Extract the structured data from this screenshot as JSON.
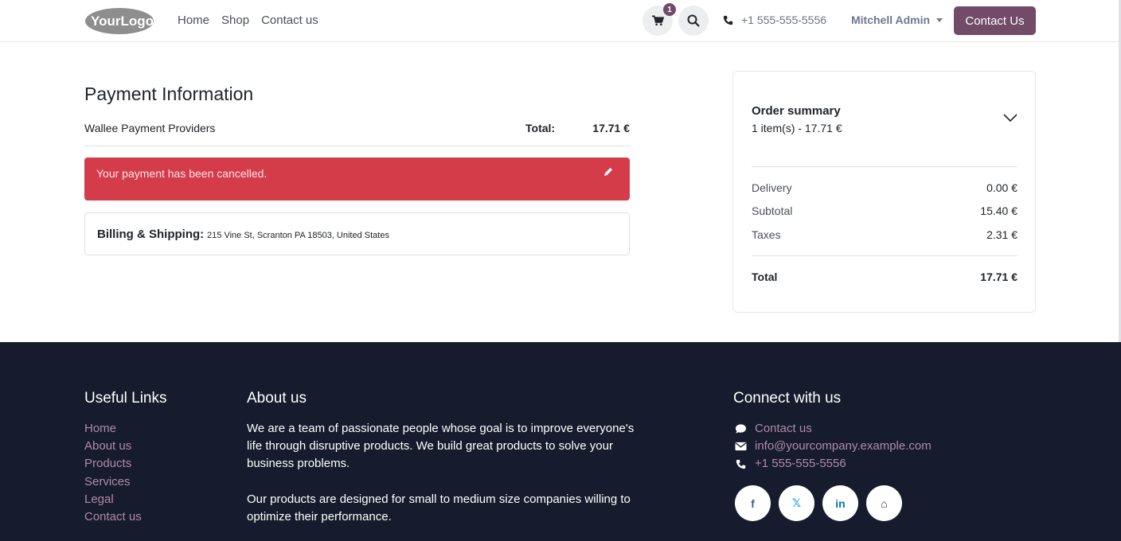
{
  "header": {
    "logo_text": "YourLogo",
    "nav": [
      "Home",
      "Shop",
      "Contact us"
    ],
    "cart_count": "1",
    "phone": "+1 555-555-5556",
    "user": "Mitchell Admin",
    "cta": "Contact Us"
  },
  "main": {
    "title": "Payment Information",
    "provider": "Wallee Payment Providers",
    "total_label": "Total:",
    "total_value": "17.71 €",
    "alert": "Your payment has been cancelled.",
    "billing_label": "Billing & Shipping:",
    "billing_address": "215 Vine St, Scranton PA 18503, United States"
  },
  "summary": {
    "title": "Order summary",
    "subtitle": "1 item(s) -  17.71 €",
    "rows": [
      {
        "label": "Delivery",
        "value": "0.00 €"
      },
      {
        "label": "Subtotal",
        "value": "15.40 €"
      },
      {
        "label": "Taxes",
        "value": "2.31 €"
      }
    ],
    "total_label": "Total",
    "total_value": "17.71 €"
  },
  "footer": {
    "links_title": "Useful Links",
    "links": [
      "Home",
      "About us",
      "Products",
      "Services",
      "Legal",
      "Contact us"
    ],
    "about_title": "About us",
    "about_p1": "We are a team of passionate people whose goal is to improve everyone's life through disruptive products. We build great products to solve your business problems.",
    "about_p2": "Our products are designed for small to medium size companies willing to optimize their performance.",
    "connect_title": "Connect with us",
    "connect": [
      {
        "icon": "comment-icon",
        "text": "Contact us"
      },
      {
        "icon": "envelope-icon",
        "text": "info@yourcompany.example.com"
      },
      {
        "icon": "phone-icon",
        "text": "+1 555-555-5556"
      }
    ],
    "socials": [
      {
        "icon": "facebook-icon",
        "glyph": "f",
        "color": "#3b5998"
      },
      {
        "icon": "x-twitter-icon",
        "glyph": "𝕏",
        "color": "#1da1f2"
      },
      {
        "icon": "linkedin-icon",
        "glyph": "in",
        "color": "#0077b5"
      },
      {
        "icon": "home-icon",
        "glyph": "⌂",
        "color": "#212529"
      }
    ]
  },
  "colors": {
    "brand": "#714b67",
    "danger": "#d43c4a",
    "footer_bg": "#161c2d",
    "link": "#b08aa9"
  }
}
